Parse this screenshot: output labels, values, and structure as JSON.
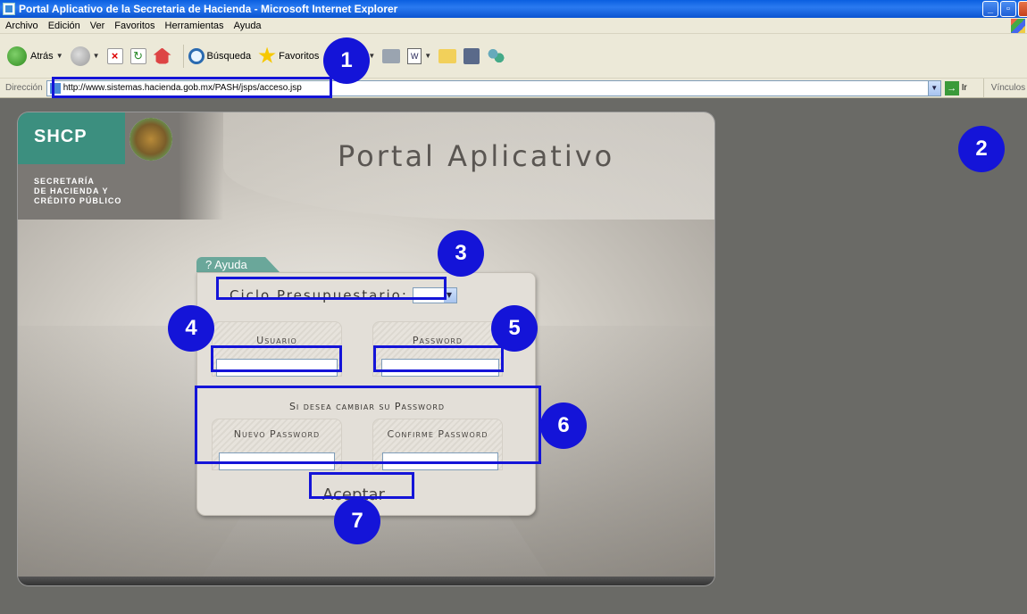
{
  "window": {
    "title": "Portal Aplicativo de la Secretaria de Hacienda - Microsoft Internet Explorer"
  },
  "menu": [
    "Archivo",
    "Edición",
    "Ver",
    "Favoritos",
    "Herramientas",
    "Ayuda"
  ],
  "toolbar": {
    "back_label": "Atrás",
    "search_label": "Búsqueda",
    "favorites_label": "Favoritos"
  },
  "address": {
    "label": "Dirección",
    "url": "http://www.sistemas.hacienda.gob.mx/PASH/jsps/acceso.jsp",
    "go_label": "Ir",
    "links_label": "Vínculos"
  },
  "portal": {
    "logo_acronym": "SHCP",
    "logo_lines": [
      "SECRETARÍA",
      "DE HACIENDA Y",
      "CRÉDITO PÚBLICO"
    ],
    "title": "Portal Aplicativo",
    "help_tab": "? Ayuda",
    "ciclo_label": "Ciclo Presupuestario:",
    "ciclo_value": "",
    "usuario_label": "Usuario",
    "usuario_value": "",
    "password_label": "Password",
    "password_value": "",
    "change_title": "Si desea cambiar su Password",
    "new_password_label": "Nuevo Password",
    "new_password_value": "",
    "confirm_password_label": "Confirme Password",
    "confirm_password_value": "",
    "submit_label": "Aceptar"
  },
  "annotations": [
    "1",
    "2",
    "3",
    "4",
    "5",
    "6",
    "7"
  ],
  "colors": {
    "annotation": "#1414d8",
    "brand_green": "#3c8f7f",
    "xp_blue": "#0a5fe0"
  }
}
